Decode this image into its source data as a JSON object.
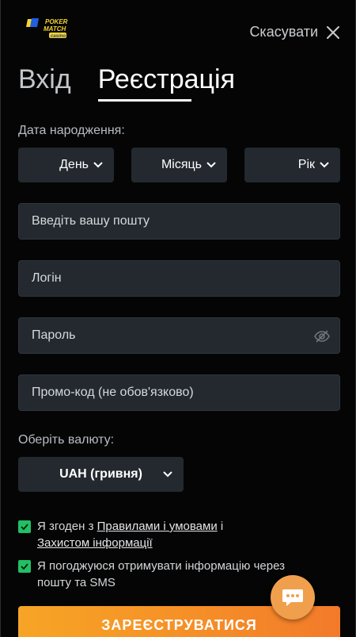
{
  "header": {
    "logo_text": "POKER MATCH casino",
    "cancel_label": "Скасувати"
  },
  "tabs": [
    {
      "label": "Вхід",
      "active": false
    },
    {
      "label": "Реєстрація",
      "active": true
    }
  ],
  "birthdate": {
    "label": "Дата народження:",
    "day": "День",
    "month": "Місяць",
    "year": "Рік"
  },
  "fields": {
    "email_placeholder": "Введіть вашу пошту",
    "login_placeholder": "Логін",
    "password_placeholder": "Пароль",
    "promo_placeholder": "Промо-код (не обов'язково)"
  },
  "currency": {
    "label": "Оберіть валюту:",
    "selected": "UAH (гривня)"
  },
  "agreements": {
    "terms_prefix": "Я згоден з ",
    "terms_link": "Правилами і умовами",
    "terms_mid": " і",
    "privacy_link": "Захистом інформації",
    "marketing_line1": "Я погоджуюся отримувати інформацію через",
    "marketing_line2": "пошту та SMS"
  },
  "submit_label": "ЗАРЕЄСТРУВАТИСЯ",
  "colors": {
    "background": "#050505",
    "field": "#23292f",
    "accent_orange": "#f58f27",
    "check_green": "#21c064",
    "logo_yellow": "#f5d431",
    "logo_blue": "#1f5fe0"
  },
  "icons": {
    "close": "close-icon",
    "chevron": "chevron-down-icon",
    "eye_hidden": "eye-slash-icon",
    "check": "check-icon",
    "chat": "chat-icon"
  }
}
